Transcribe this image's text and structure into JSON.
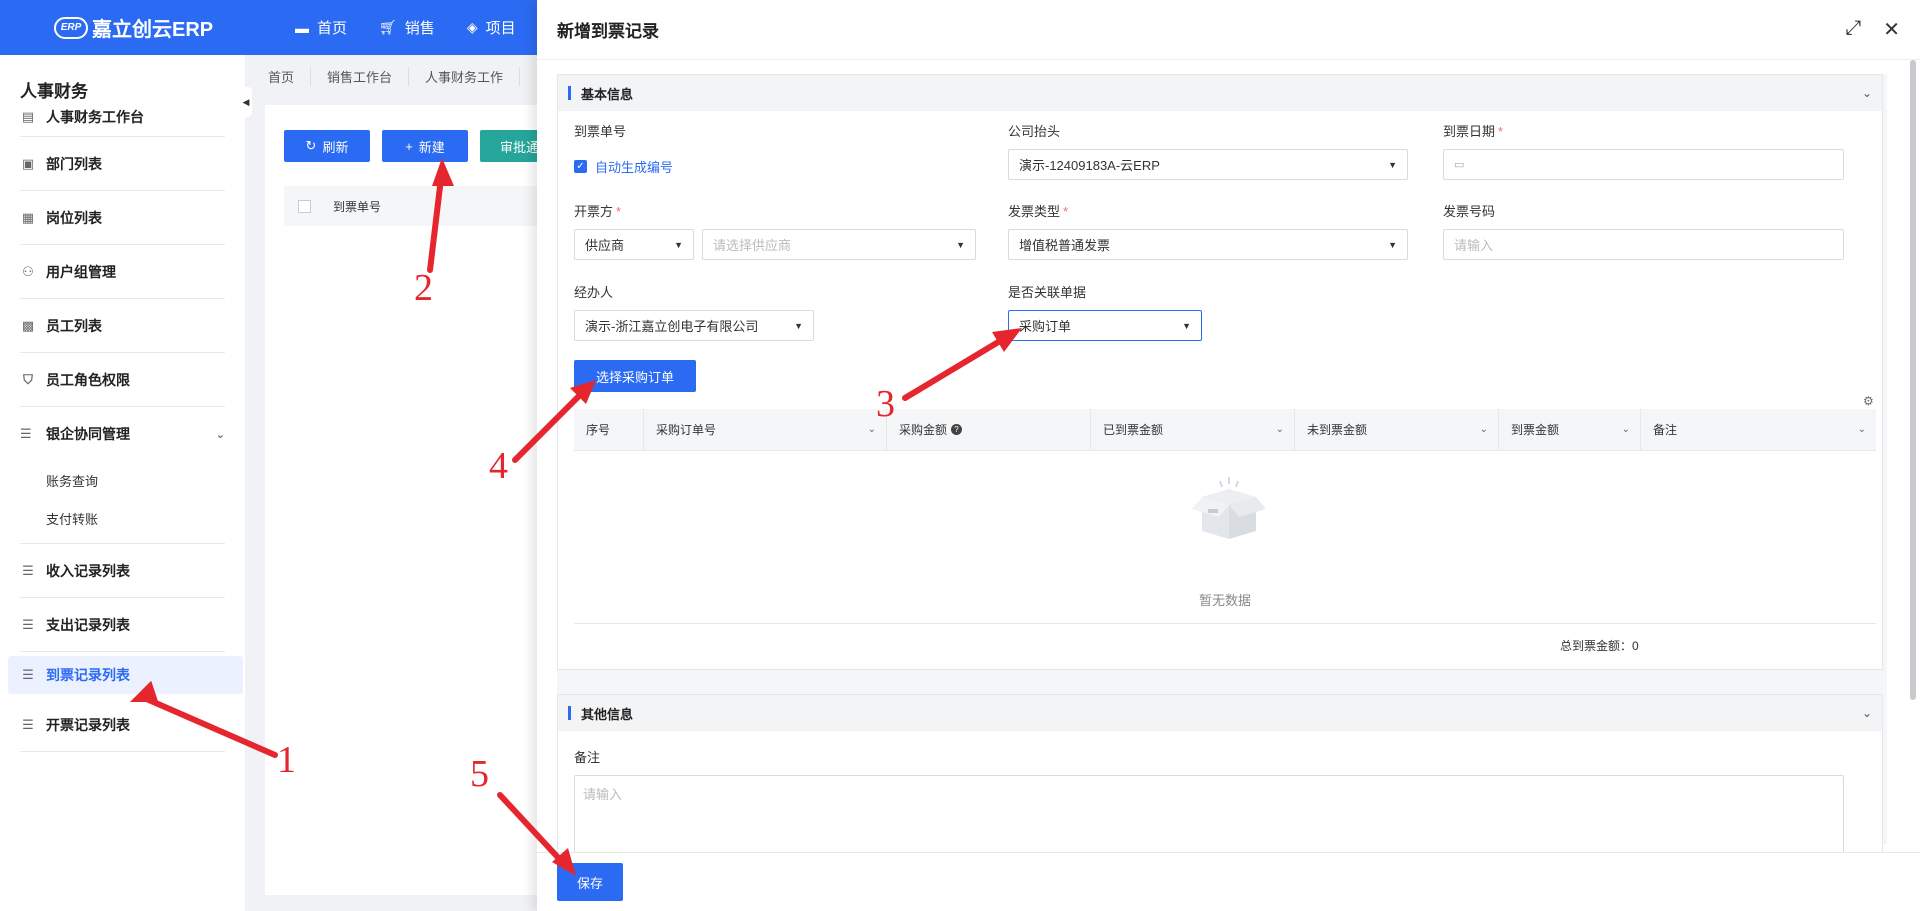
{
  "topbar": {
    "logo_text": "嘉立创云ERP",
    "logo_mark": "ERP",
    "nav": [
      {
        "label": "首页",
        "icon": "monitor-icon"
      },
      {
        "label": "销售",
        "icon": "cart-icon"
      },
      {
        "label": "项目",
        "icon": "layers-icon"
      }
    ]
  },
  "sidebar": {
    "title": "人事财务",
    "items": [
      {
        "label": "人事财务工作台",
        "icon": "chart-icon"
      },
      {
        "label": "部门列表",
        "icon": "doc-icon"
      },
      {
        "label": "岗位列表",
        "icon": "id-card-icon"
      },
      {
        "label": "用户组管理",
        "icon": "users-icon"
      },
      {
        "label": "员工列表",
        "icon": "folder-user-icon"
      },
      {
        "label": "员工角色权限",
        "icon": "shield-icon"
      }
    ],
    "group": {
      "label": "银企协同管理",
      "icon": "list-icon",
      "children": [
        "账务查询",
        "支付转账"
      ]
    },
    "items2": [
      {
        "label": "收入记录列表",
        "icon": "list-icon"
      },
      {
        "label": "支出记录列表",
        "icon": "list-icon"
      },
      {
        "label": "到票记录列表",
        "icon": "list-icon",
        "active": true
      },
      {
        "label": "开票记录列表",
        "icon": "list-icon"
      }
    ]
  },
  "background_page": {
    "tabs": [
      "首页",
      "销售工作台",
      "人事财务工作"
    ],
    "buttons": {
      "refresh": "刷新",
      "new": "新建",
      "approve": "审批通"
    },
    "table_col": "到票单号"
  },
  "drawer": {
    "title": "新增到票记录",
    "basic_section": {
      "title": "基本信息",
      "invoice_no_label": "到票单号",
      "auto_gen_label": "自动生成编号",
      "company_label": "公司抬头",
      "company_value": "演示-12409183A-云ERP",
      "date_label": "到票日期",
      "issuer_label": "开票方",
      "issuer_type": "供应商",
      "issuer_placeholder": "请选择供应商",
      "invoice_type_label": "发票类型",
      "invoice_type_value": "增值税普通发票",
      "invoice_number_label": "发票号码",
      "invoice_number_placeholder": "请输入",
      "handler_label": "经办人",
      "handler_value": "演示-浙江嘉立创电子有限公司",
      "linked_label": "是否关联单据",
      "linked_value": "采购订单",
      "select_po_button": "选择采购订单"
    },
    "table": {
      "columns": [
        "序号",
        "采购订单号",
        "采购金额",
        "已到票金额",
        "未到票金额",
        "到票金额",
        "备注"
      ],
      "empty_text": "暂无数据",
      "total_label": "总到票金额：",
      "total_value": "0"
    },
    "other_section": {
      "title": "其他信息",
      "remark_label": "备注",
      "remark_placeholder": "请输入"
    },
    "save_button": "保存"
  },
  "annotations": [
    "1",
    "2",
    "3",
    "4",
    "5"
  ],
  "colors": {
    "primary": "#2b6bf3",
    "annotation": "#e6262f",
    "approve_green": "#26a69a"
  }
}
